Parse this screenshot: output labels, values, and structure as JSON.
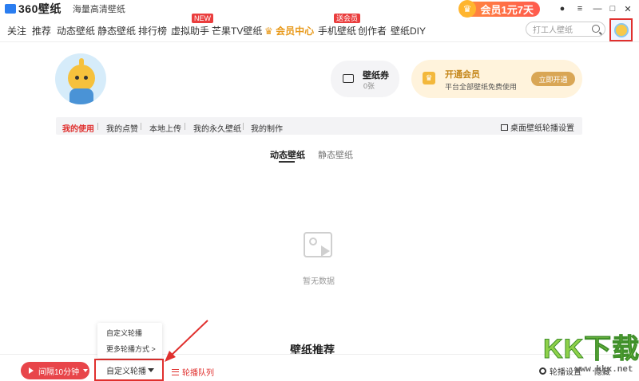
{
  "app": {
    "logo_text": "360壁纸",
    "slogan": "海量高清壁纸",
    "vip_promo": "会员1元7天"
  },
  "window_controls": [
    "notification-icon",
    "settings-icon",
    "minimize-icon",
    "maximize-icon",
    "close-icon"
  ],
  "nav": {
    "items": [
      "关注",
      "推荐",
      "动态壁纸",
      "静态壁纸",
      "排行榜",
      "虚拟助手",
      "芒果TV壁纸",
      "会员中心",
      "手机壁纸",
      "创作者",
      "壁纸DIY"
    ],
    "badge_new": "NEW",
    "badge_vip": "送会员",
    "search_placeholder": "打工人壁纸"
  },
  "profile": {
    "coupon_title": "壁纸券",
    "coupon_count": "0张",
    "vip_title": "开通会员",
    "vip_desc": "平台全部壁纸免费使用",
    "vip_button": "立即开通"
  },
  "subtabs": {
    "items": [
      "我的使用",
      "我的点赞",
      "本地上传",
      "我的永久壁纸",
      "我的制作"
    ],
    "active": "我的使用",
    "carousel_settings": "桌面壁纸轮播设置"
  },
  "type_tabs": {
    "items": [
      "动态壁纸",
      "静态壁纸"
    ],
    "active": "动态壁纸"
  },
  "empty": {
    "text": "暂无数据"
  },
  "recommend_title": "壁纸推荐",
  "popup": {
    "options": [
      "自定义轮播",
      "更多轮播方式 >"
    ]
  },
  "bottombar": {
    "interval_label": "间隔10分钟",
    "mode_label": "自定义轮播",
    "queue_label": "轮播队列",
    "settings_label": "轮播设置",
    "hide_label": "隐藏"
  },
  "watermark": {
    "letters": [
      "K",
      "K",
      "下",
      "载"
    ],
    "url": "www.kkx.net"
  },
  "colors": {
    "accent_red": "#e0302e",
    "vip_gold": "#e89a1c",
    "brand_blue": "#2a7df0"
  }
}
